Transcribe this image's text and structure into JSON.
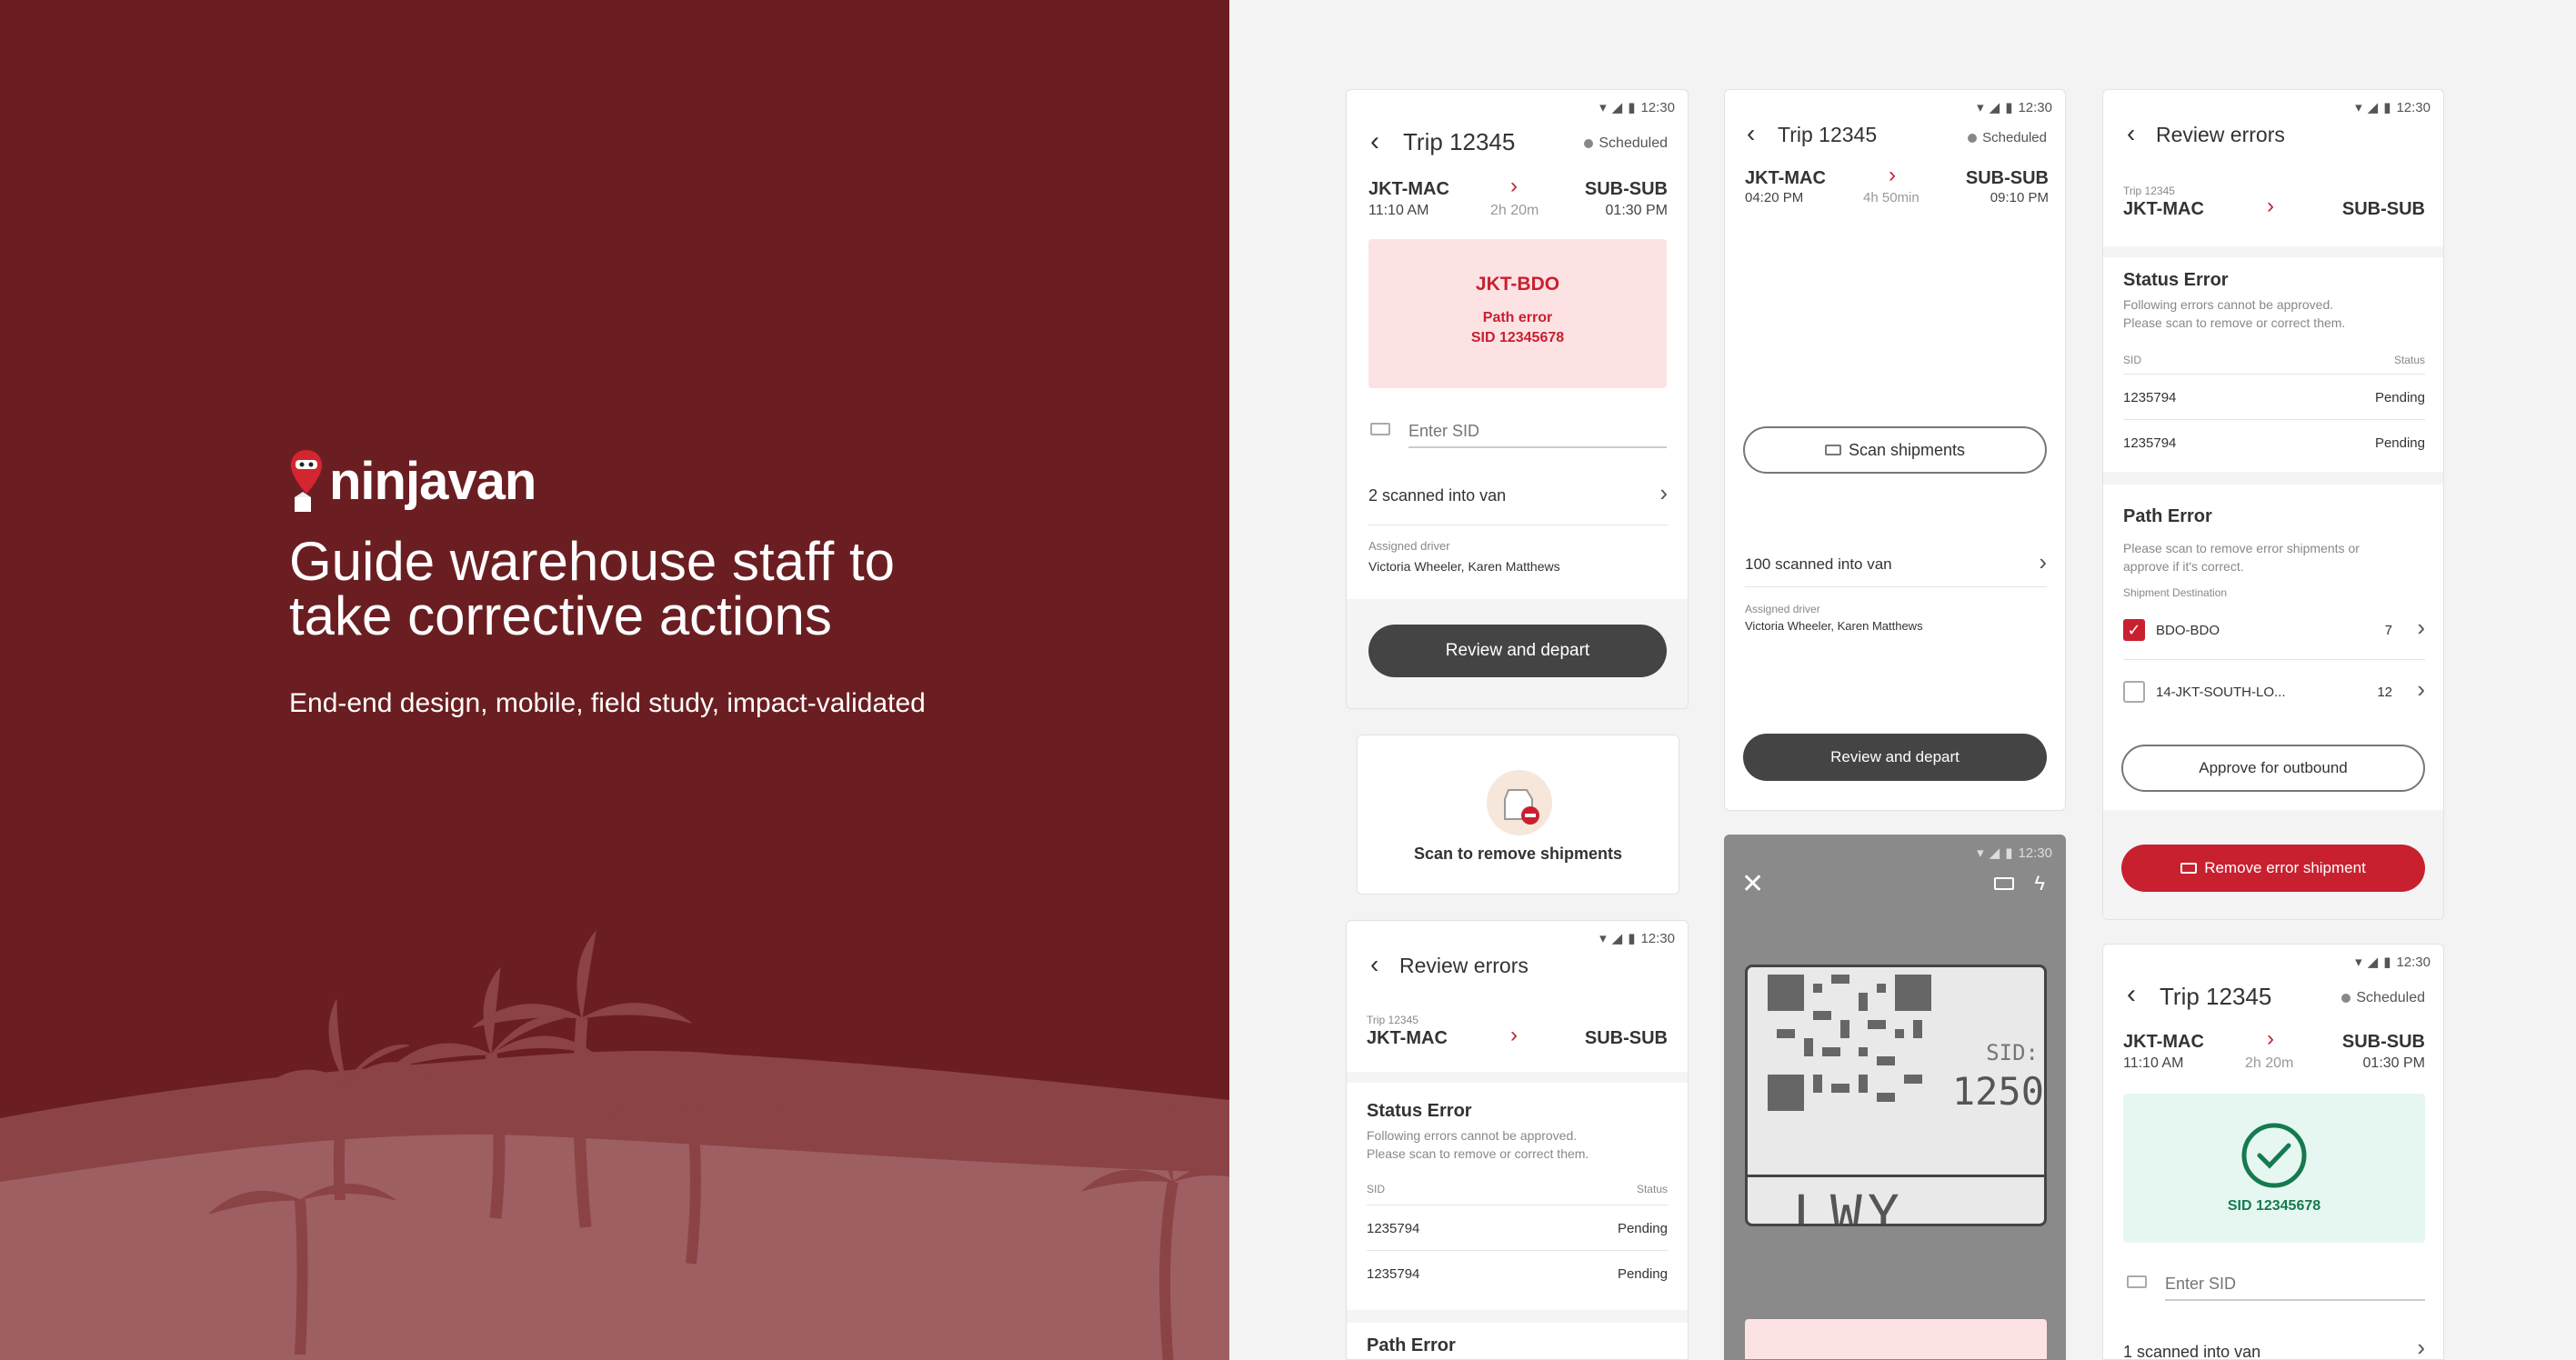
{
  "hero": {
    "brand": "ninjavan",
    "headline_line1": "Guide warehouse staff to",
    "headline_line2": "take corrective actions",
    "subline": "End-end design, mobile, field study, impact-validated",
    "colors": {
      "background": "#6b1e21",
      "land": "#9a5b5d",
      "accent": "#c8202f"
    }
  },
  "status_bar": {
    "time": "12:30"
  },
  "screen1": {
    "title": "Trip 12345",
    "status": "Scheduled",
    "from_station": "JKT-MAC",
    "from_time": "11:10 AM",
    "duration": "2h 20m",
    "to_station": "SUB-SUB",
    "to_time": "01:30 PM",
    "error_station": "JKT-BDO",
    "error_type": "Path error",
    "error_sid": "SID 12345678",
    "sid_placeholder": "Enter SID",
    "scanned": "2 scanned into van",
    "driver_label": "Assigned driver",
    "drivers": "Victoria Wheeler, Karen Matthews",
    "cta": "Review and depart"
  },
  "card_scan_remove": {
    "label": "Scan to remove shipments"
  },
  "screen2": {
    "title": "Trip 12345",
    "status": "Scheduled",
    "from_station": "JKT-MAC",
    "from_time": "04:20 PM",
    "duration": "4h 50min",
    "to_station": "SUB-SUB",
    "to_time": "09:10 PM",
    "scan_button": "Scan shipments",
    "scanned": "100 scanned into van",
    "driver_label": "Assigned driver",
    "drivers": "Victoria Wheeler, Karen Matthews",
    "cta": "Review and depart"
  },
  "scanner": {
    "label_sid": "SID:",
    "label_num": "1250",
    "label_code": "LWY"
  },
  "review1": {
    "title": "Review errors",
    "trip": "Trip 12345",
    "from_station": "JKT-MAC",
    "to_station": "SUB-SUB",
    "status_error_title": "Status Error",
    "status_error_desc1": "Following errors cannot be approved.",
    "status_error_desc2": "Please scan to remove or correct them.",
    "col_sid": "SID",
    "col_status": "Status",
    "rows": [
      {
        "sid": "1235794",
        "status": "Pending"
      },
      {
        "sid": "1235794",
        "status": "Pending"
      }
    ],
    "path_error_title": "Path Error",
    "path_error_desc1": "Please scan to remove error shipments or",
    "path_error_desc2": "approve if it's correct.",
    "dest_label": "Shipment Destination",
    "destinations": [
      {
        "name": "BDO-BDO",
        "count": "7",
        "checked": true
      },
      {
        "name": "14-JKT-SOUTH-LO...",
        "count": "12",
        "checked": false
      }
    ],
    "approve": "Approve for outbound",
    "remove": "Remove error shipment"
  },
  "review2": {
    "title": "Review errors",
    "trip": "Trip 12345",
    "from_station": "JKT-MAC",
    "to_station": "SUB-SUB",
    "status_error_title": "Status Error",
    "status_error_desc1": "Following errors cannot be approved.",
    "status_error_desc2": "Please scan to remove or correct them.",
    "col_sid": "SID",
    "col_status": "Status",
    "rows": [
      {
        "sid": "1235794",
        "status": "Pending"
      },
      {
        "sid": "1235794",
        "status": "Pending"
      }
    ],
    "path_error_title": "Path Error"
  },
  "screen_success": {
    "title": "Trip 12345",
    "status": "Scheduled",
    "from_station": "JKT-MAC",
    "from_time": "11:10 AM",
    "duration": "2h 20m",
    "to_station": "SUB-SUB",
    "to_time": "01:30 PM",
    "success_sid": "SID 12345678",
    "sid_placeholder": "Enter SID",
    "scanned": "1 scanned into van"
  }
}
